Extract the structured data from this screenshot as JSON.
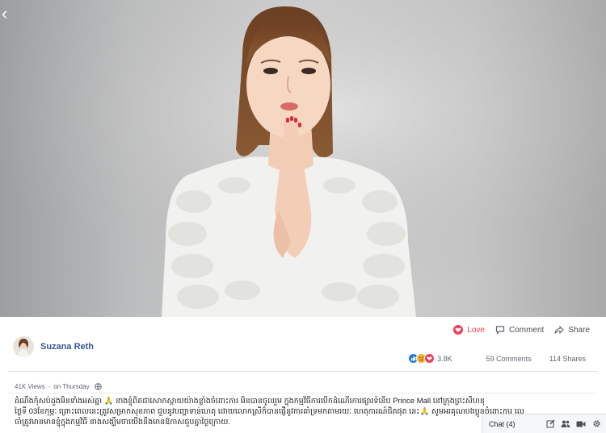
{
  "video": {
    "back_icon": "chevron-left-icon"
  },
  "post": {
    "author": "Suzana Reth",
    "actions": {
      "love": "Love",
      "comment": "Comment",
      "share": "Share"
    },
    "reactions": {
      "count": "3.8K",
      "icons": [
        "like-icon",
        "sad-icon",
        "love-icon"
      ]
    },
    "comments": "59 Comments",
    "shares": "114 Shares",
    "views": "41K Views",
    "separator": "·",
    "time": "on Thursday",
    "privacy_icon": "globe-icon",
    "caption_lines": [
      "ដំណឹងកុំសប់ដួងមិនទាំងអស់គ្នា 🙏 នាងខ្ញុំពិតជាសោកស្ដាយយ៉ាងខ្លាំងចំពោះការ មិនបានចូលរួម ក្នុងកម្មវិធីការបើកដំណើរការផ្សារទំនើប Prince Mall នៅក្រុងព្រះសីហនុ",
      "ថ្ងៃទី 03ខែកុម្ភៈ ព្រោះពេលនេះត្រូវសម្រាកសុខភាព ជួបនូវបញ្ហាទាន់ហេតុ ដោយលោកស្រីក៏បានផ្ញើនូវការគាំទ្រមកតាមរយៈ ហេតុការណ៍ជិតផុត នេះ🙏 សូមអរគុណបងប្អូនចំពោះការ លេ",
      "ចាំត្រូវមានមានខ្ញុំក្នុងកម្មវិធី នាងសង្ឃឹមថាយើងនឹងមានឱកាសជួបគ្នាថ្ងៃក្រោយ."
    ]
  },
  "chat": {
    "label": "Chat (4)",
    "icons": [
      "compose-icon",
      "group-icon",
      "video-call-icon",
      "settings-icon"
    ]
  },
  "colors": {
    "link": "#385898",
    "love": "#f33e58",
    "like": "#1877f2",
    "sad": "#f7b125"
  }
}
